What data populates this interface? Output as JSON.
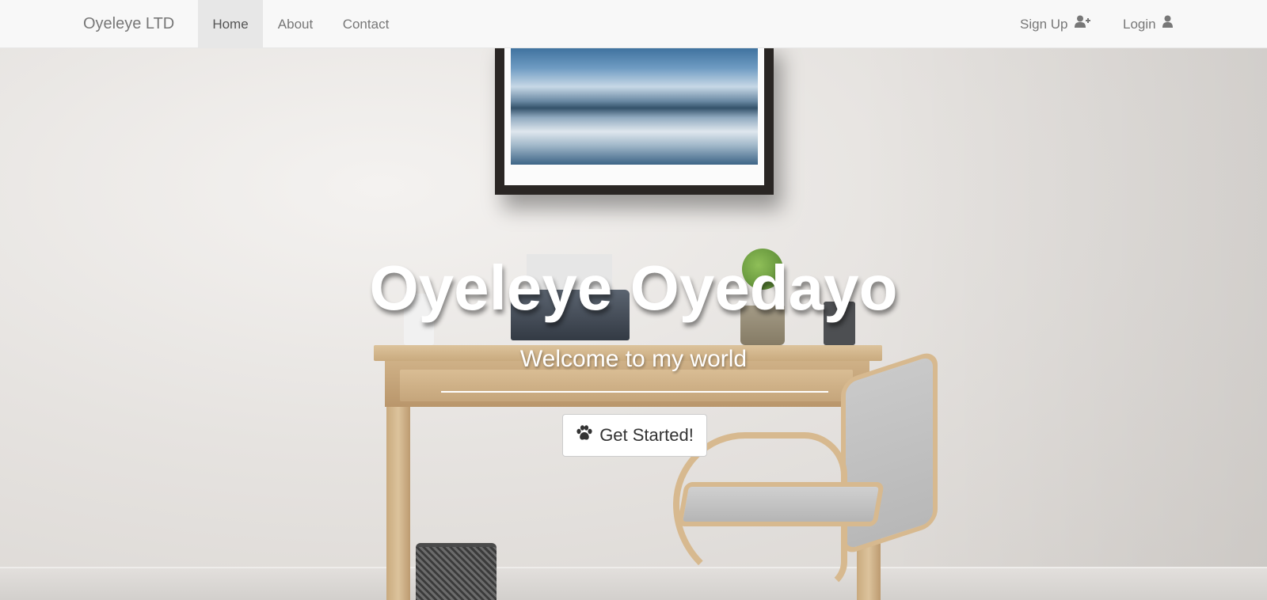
{
  "navbar": {
    "brand": "Oyeleye LTD",
    "links": [
      {
        "label": "Home",
        "active": true
      },
      {
        "label": "About",
        "active": false
      },
      {
        "label": "Contact",
        "active": false
      }
    ],
    "signup_label": "Sign Up",
    "signup_icon": "user-plus-icon",
    "login_label": "Login",
    "login_icon": "user-icon"
  },
  "hero": {
    "title": "Oyeleye Oyedayo",
    "subtitle": "Welcome to my world",
    "cta_label": "Get Started!",
    "cta_icon": "paw-icon",
    "background": "room-desk-chair-photo"
  },
  "colors": {
    "navbar_bg": "#f8f8f8",
    "nav_text": "#777777",
    "nav_active_bg": "#e7e7e7",
    "hero_text": "#ffffff",
    "button_bg": "#ffffff",
    "button_text": "#333333"
  }
}
